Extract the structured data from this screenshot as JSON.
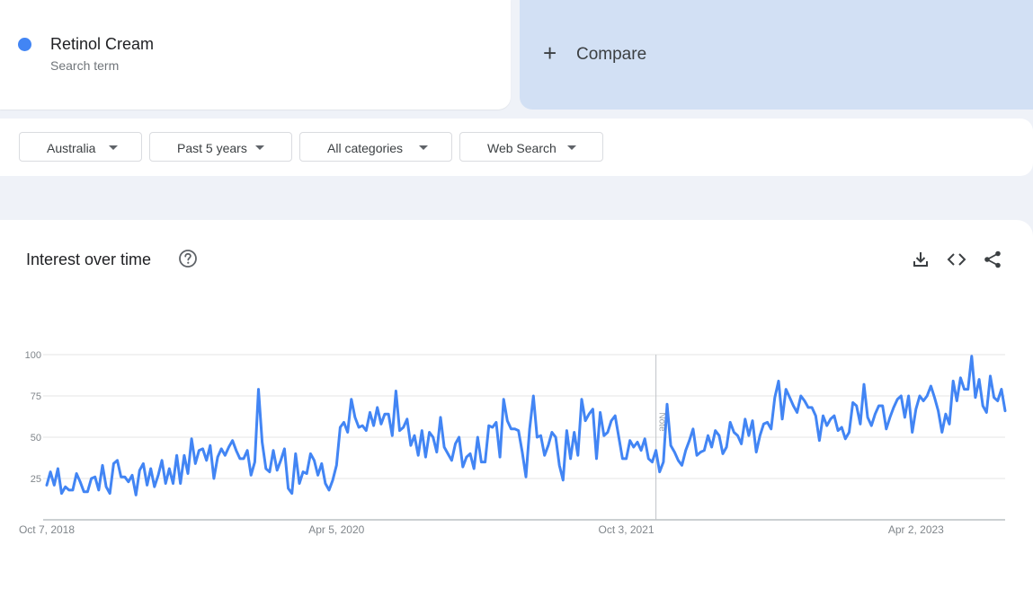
{
  "term": {
    "name": "Retinol Cream",
    "subtitle": "Search term",
    "color": "#4285f4"
  },
  "compare": {
    "label": "Compare"
  },
  "filters": {
    "region": "Australia",
    "period": "Past 5 years",
    "category": "All categories",
    "property": "Web Search"
  },
  "panel": {
    "title": "Interest over time"
  },
  "icons": [
    "help-icon",
    "download-icon",
    "embed-code-icon",
    "share-icon"
  ],
  "chart_data": {
    "type": "line",
    "title": "Interest over time",
    "xlabel": "",
    "ylabel": "",
    "ylim": [
      0,
      100
    ],
    "y_ticks": [
      25,
      50,
      75,
      100
    ],
    "x_tick_labels": [
      "Oct 7, 2018",
      "Apr 5, 2020",
      "Oct 3, 2021",
      "Apr 2, 2023"
    ],
    "x_start": "Oct 7, 2018",
    "x_interval": "weekly",
    "annotation": {
      "label": "Note",
      "at": "Nov 28, 2021"
    },
    "grid": true,
    "legend": "none",
    "series": [
      {
        "color": "#4285f4",
        "values": [
          21,
          29,
          21,
          31,
          16,
          20,
          18,
          18,
          28,
          23,
          17,
          17,
          25,
          26,
          18,
          33,
          20,
          16,
          34,
          36,
          26,
          26,
          23,
          27,
          15,
          30,
          34,
          21,
          31,
          20,
          27,
          36,
          22,
          31,
          22,
          39,
          22,
          39,
          28,
          49,
          34,
          42,
          43,
          36,
          45,
          25,
          38,
          43,
          39,
          44,
          48,
          42,
          37,
          37,
          42,
          27,
          35,
          79,
          47,
          31,
          29,
          42,
          30,
          36,
          43,
          19,
          16,
          40,
          22,
          29,
          28,
          40,
          36,
          27,
          34,
          22,
          18,
          24,
          33,
          56,
          59,
          53,
          73,
          62,
          56,
          57,
          54,
          65,
          57,
          68,
          58,
          64,
          64,
          51,
          78,
          54,
          56,
          61,
          45,
          51,
          39,
          54,
          38,
          53,
          50,
          41,
          62,
          44,
          40,
          36,
          46,
          50,
          32,
          38,
          40,
          31,
          50,
          35,
          35,
          57,
          56,
          59,
          38,
          73,
          60,
          55,
          55,
          54,
          41,
          26,
          55,
          75,
          50,
          51,
          39,
          45,
          53,
          50,
          33,
          24,
          54,
          37,
          53,
          39,
          73,
          60,
          64,
          67,
          37,
          65,
          51,
          53,
          60,
          63,
          50,
          37,
          37,
          48,
          44,
          47,
          42,
          49,
          37,
          35,
          42,
          29,
          35,
          70,
          45,
          41,
          36,
          33,
          42,
          48,
          55,
          39,
          41,
          42,
          51,
          44,
          54,
          51,
          40,
          44,
          59,
          53,
          51,
          46,
          61,
          51,
          60,
          41,
          51,
          58,
          59,
          55,
          74,
          84,
          61,
          79,
          74,
          69,
          65,
          75,
          72,
          68,
          68,
          63,
          48,
          63,
          57,
          61,
          63,
          54,
          56,
          49,
          53,
          71,
          69,
          58,
          82,
          62,
          57,
          64,
          69,
          69,
          55,
          62,
          68,
          73,
          75,
          62,
          75,
          53,
          67,
          75,
          72,
          75,
          81,
          74,
          66,
          53,
          64,
          58,
          84,
          72,
          86,
          79,
          79,
          99,
          74,
          85,
          69,
          65,
          87,
          74,
          72,
          79,
          66
        ]
      }
    ]
  }
}
